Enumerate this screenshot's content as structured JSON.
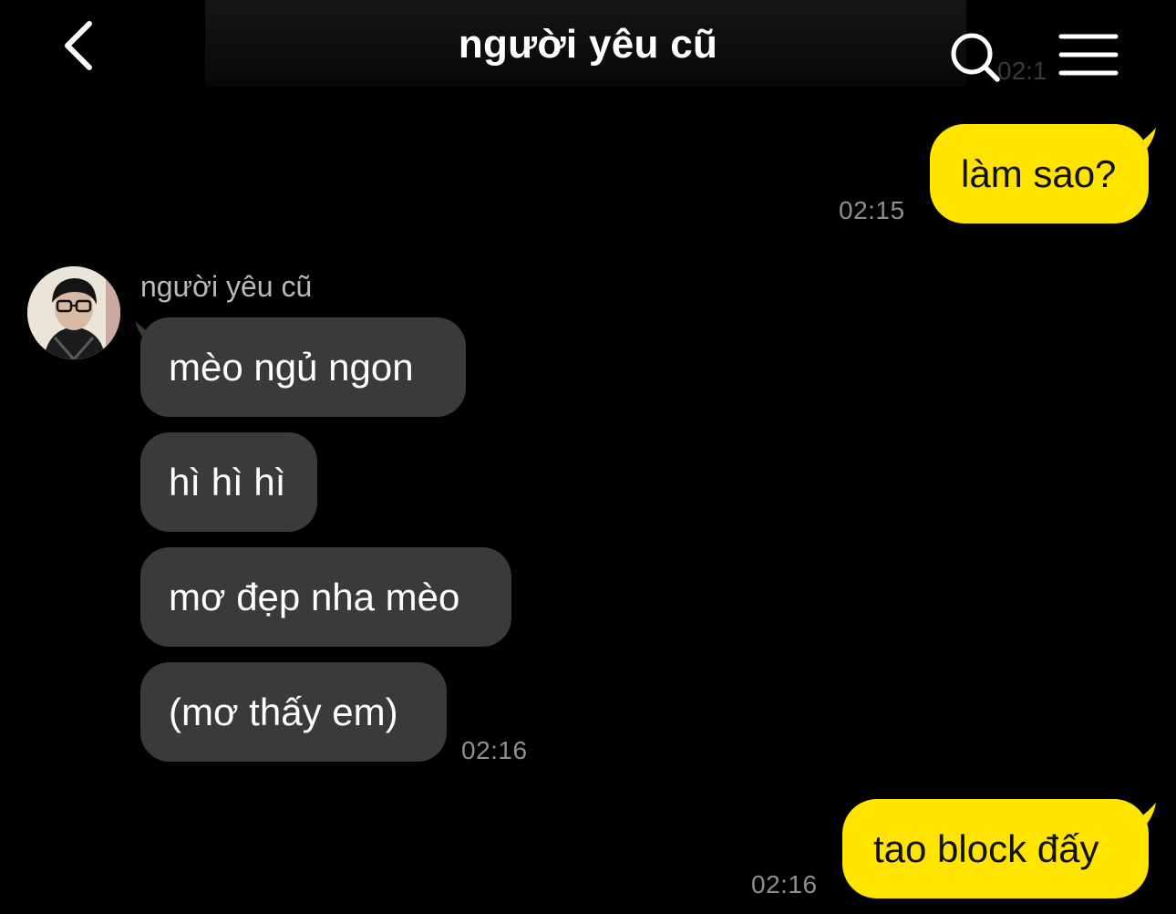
{
  "header": {
    "title": "người yêu cũ",
    "back_icon": "chevron-left-icon",
    "search_icon": "search-icon",
    "menu_icon": "hamburger-menu-icon",
    "ghost_time": "02:1"
  },
  "colors": {
    "background": "#000000",
    "outgoing_bubble": "#ffe400",
    "incoming_bubble": "#3a3a3c",
    "timestamp": "#8e8e93"
  },
  "messages": [
    {
      "direction": "out",
      "text": "làm sao?",
      "time": "02:15"
    },
    {
      "direction": "in",
      "sender": "người yêu cũ",
      "text": "mèo ngủ ngon"
    },
    {
      "direction": "in",
      "text": "hì hì hì"
    },
    {
      "direction": "in",
      "text": "mơ đẹp nha mèo"
    },
    {
      "direction": "in",
      "text": "(mơ thấy em)",
      "time": "02:16"
    },
    {
      "direction": "out",
      "text": "tao block đấy",
      "time": "02:16"
    }
  ]
}
